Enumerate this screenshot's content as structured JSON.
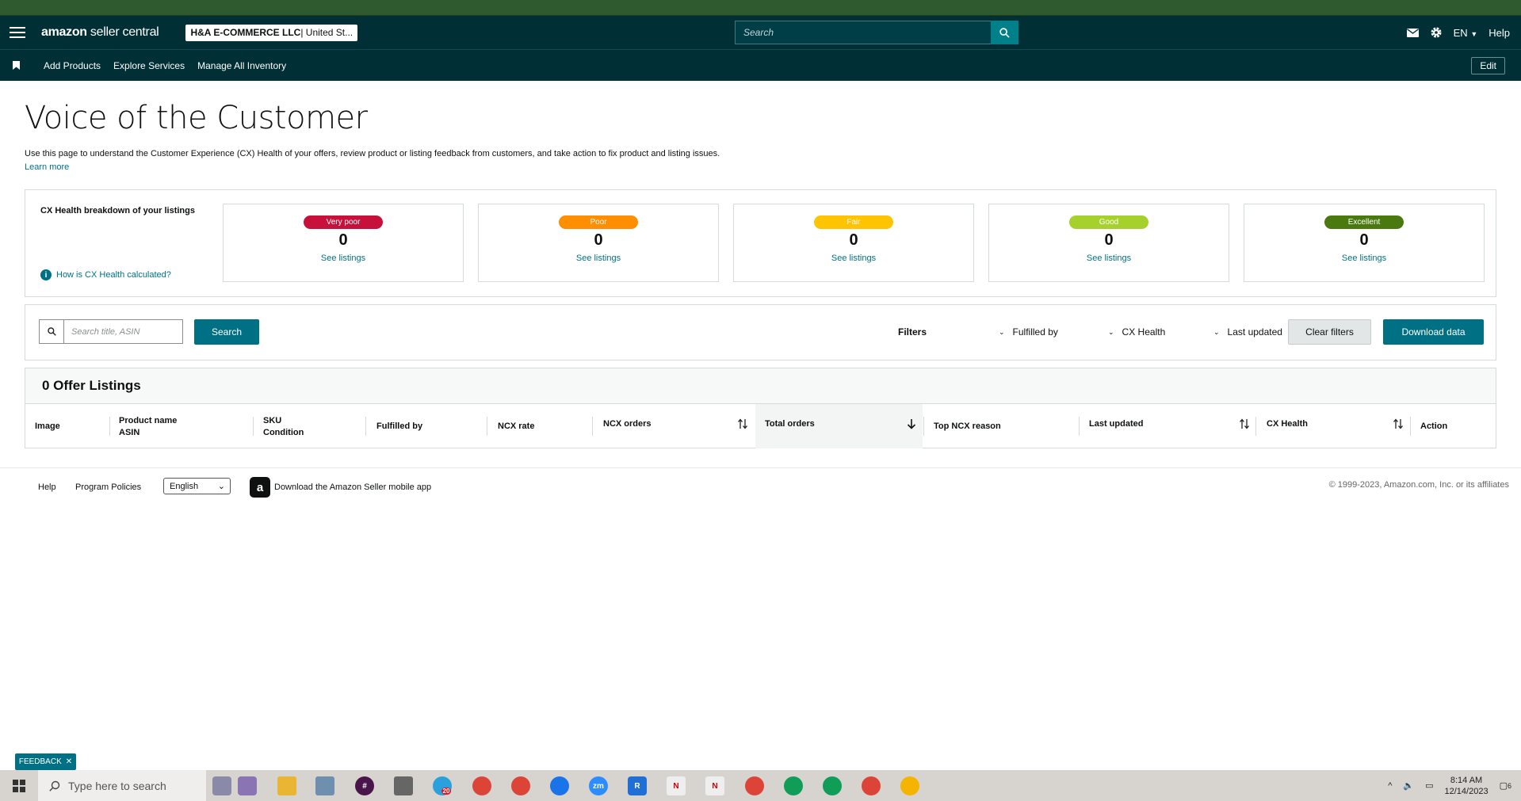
{
  "header": {
    "logo_main": "amazon",
    "logo_sub": " seller central",
    "account_name": "H&A E-COMMERCE LLC",
    "account_market": " | United St...",
    "search_placeholder": "Search",
    "lang": "EN",
    "help": "Help"
  },
  "nav": {
    "items": [
      "Add Products",
      "Explore Services",
      "Manage All Inventory"
    ],
    "edit": "Edit"
  },
  "page": {
    "title": "Voice of the Customer",
    "intro": "Use this page to understand the Customer Experience (CX) Health of your offers, review product or listing feedback from customers, and take action to fix product and listing issues.",
    "learn_more": "Learn more"
  },
  "cx": {
    "title": "CX Health breakdown of your listings",
    "help_link": "How is CX Health calculated?",
    "cards": [
      {
        "label": "Very poor",
        "count": "0",
        "link": "See listings",
        "color": "#c7103b"
      },
      {
        "label": "Poor",
        "count": "0",
        "link": "See listings",
        "color": "#ff8f00"
      },
      {
        "label": "Fair",
        "count": "0",
        "link": "See listings",
        "color": "#ffc400"
      },
      {
        "label": "Good",
        "count": "0",
        "link": "See listings",
        "color": "#a6d12c"
      },
      {
        "label": "Excellent",
        "count": "0",
        "link": "See listings",
        "color": "#4a7a0f"
      }
    ]
  },
  "filters": {
    "search_placeholder": "Search title, ASIN",
    "search_button": "Search",
    "label": "Filters",
    "dropdowns": [
      "Fulfilled by",
      "CX Health",
      "Last updated"
    ],
    "clear": "Clear filters",
    "download": "Download data"
  },
  "listings": {
    "heading": "0 Offer Listings",
    "columns": {
      "image": "Image",
      "product_name": "Product name",
      "asin": "ASIN",
      "sku": "SKU",
      "condition": "Condition",
      "fulfilled_by": "Fulfilled by",
      "ncx_rate": "NCX rate",
      "ncx_orders": "NCX orders",
      "total_orders": "Total orders",
      "top_ncx_reason": "Top NCX reason",
      "last_updated": "Last updated",
      "cx_health": "CX Health",
      "action": "Action"
    }
  },
  "footer": {
    "help": "Help",
    "policies": "Program Policies",
    "language": "English",
    "app": "Download the Amazon Seller mobile app",
    "copyright": "© 1999-2023, Amazon.com, Inc. or its affiliates"
  },
  "feedback": "FEEDBACK",
  "taskbar": {
    "search_placeholder": "Type here to search",
    "time": "8:14 AM",
    "date": "12/14/2023",
    "notif_count": "6",
    "badge_count": "20"
  },
  "colors": {
    "teal": "#007185",
    "header": "#002f36"
  }
}
